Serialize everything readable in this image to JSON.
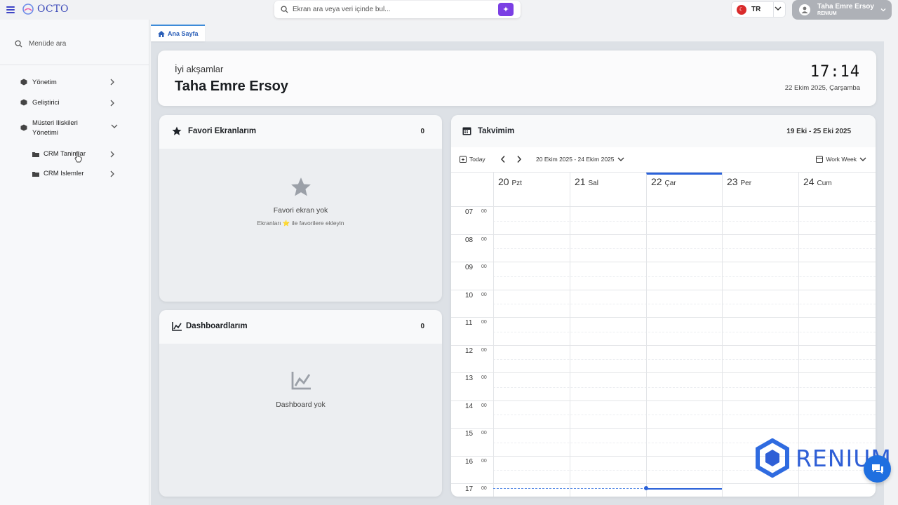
{
  "app": {
    "logo_text": "OCTO"
  },
  "topbar": {
    "search_placeholder": "Ekran ara veya veri içinde bul...",
    "language": "TR",
    "user_name": "Taha Emre Ersoy",
    "user_org": "RENIUM"
  },
  "sidebar": {
    "search_placeholder": "Menüde ara",
    "items": [
      {
        "label": "Yönetim"
      },
      {
        "label": "Geliştirici"
      },
      {
        "label": "Müsteri Iliskileri Yönetimi"
      }
    ],
    "subitems": [
      {
        "label": "CRM Tanimlar"
      },
      {
        "label": "CRM Islemler"
      }
    ]
  },
  "tab": {
    "label": "Ana Sayfa"
  },
  "greeting": {
    "subtitle": "İyi akşamlar",
    "name": "Taha Emre Ersoy",
    "time": "17:14",
    "date": "22 Ekim 2025, Çarşamba"
  },
  "favorites": {
    "title": "Favori Ekranlarım",
    "count": "0",
    "empty_title": "Favori ekran yok",
    "empty_sub": "Ekranları ⭐ ile favorilere ekleyin"
  },
  "dashboards": {
    "title": "Dashboardlarım",
    "count": "0",
    "empty_title": "Dashboard yok"
  },
  "calendar": {
    "title": "Takvimim",
    "range": "19 Eki - 25 Eki 2025",
    "today_label": "Today",
    "date_range": "20 Ekim 2025 - 24 Ekim 2025",
    "view": "Work Week",
    "days": [
      {
        "num": "20",
        "label": "Pzt"
      },
      {
        "num": "21",
        "label": "Sal"
      },
      {
        "num": "22",
        "label": "Çar"
      },
      {
        "num": "23",
        "label": "Per"
      },
      {
        "num": "24",
        "label": "Cum"
      }
    ],
    "hours": [
      "07",
      "08",
      "09",
      "10",
      "11",
      "12",
      "13",
      "14",
      "15",
      "16",
      "17"
    ],
    "minutes": "00"
  },
  "brand": {
    "text": "RENIUM"
  },
  "colors": {
    "accent": "#2b62d9",
    "ai_button": "#7b3fe4",
    "brand": "#2f5fd6"
  }
}
